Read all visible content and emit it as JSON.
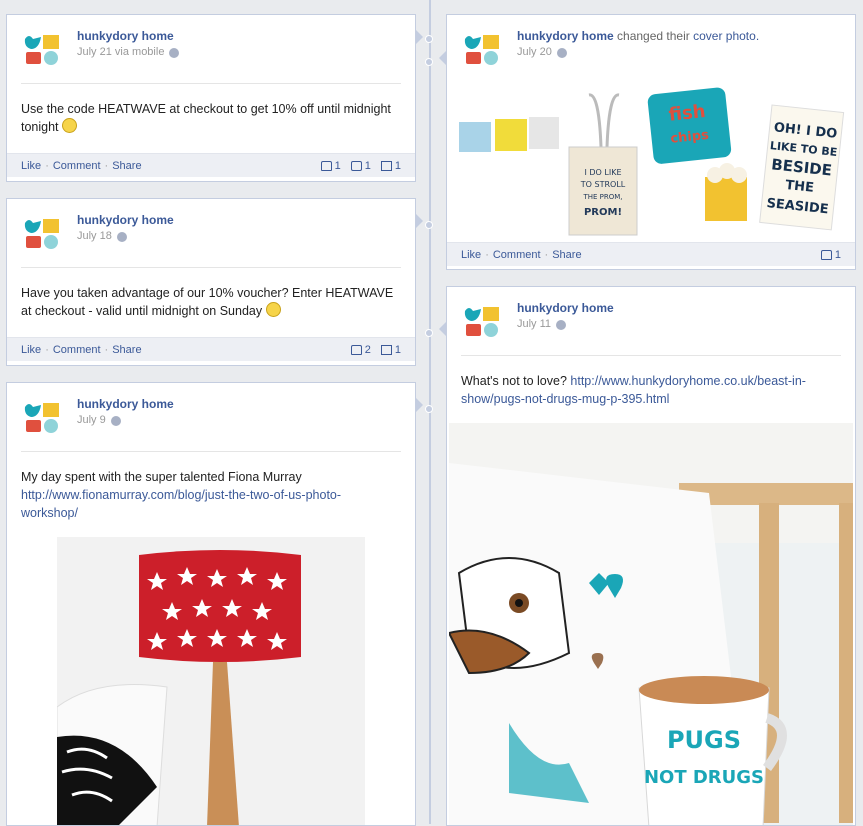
{
  "page_name": "hunkydory home",
  "posts": [
    {
      "id": "p1",
      "date": "July 21 via mobile",
      "text": "Use the code HEATWAVE at checkout to get 10% off until midnight tonight",
      "actions": [
        "Like",
        "Comment",
        "Share"
      ],
      "counts": {
        "likes": "1",
        "comments": "1",
        "shares": "1"
      }
    },
    {
      "id": "p2",
      "date": "July 20",
      "action_text": "changed their",
      "action_link": "cover photo.",
      "actions": [
        "Like",
        "Comment",
        "Share"
      ],
      "counts": {
        "likes": "1"
      },
      "image": {
        "cushion_text": "fish & chips",
        "bag_text": "I DO LIKE TO STROLL ALONG THE PROM, PROM, PROM!",
        "towel_text": "OH! I DO LIKE TO BE BESIDE THE SEASIDE"
      }
    },
    {
      "id": "p3",
      "date": "July 18",
      "text": "Have you taken advantage of our 10% voucher? Enter HEATWAVE at checkout - valid until midnight on Sunday",
      "actions": [
        "Like",
        "Comment",
        "Share"
      ],
      "counts": {
        "likes": "2",
        "shares": "1"
      }
    },
    {
      "id": "p4",
      "date": "July 11",
      "text": "What's not to love?",
      "link": "http://www.hunkydoryhome.co.uk/beast-in-show/pugs-not-drugs-mug-p-395.html",
      "image": {
        "mug_text_1": "PUGS",
        "mug_text_2": "NOT DRUGS"
      }
    },
    {
      "id": "p5",
      "date": "July 9",
      "text": "My day spent with the super talented Fiona Murray",
      "link": "http://www.fionamurray.com/blog/just-the-two-of-us-photo-workshop/"
    }
  ],
  "colors": {
    "brand_blue": "#3b5998",
    "timeline_line": "#c4cde0",
    "lamp_red": "#cc1f2a",
    "teal": "#1aa6b7"
  }
}
